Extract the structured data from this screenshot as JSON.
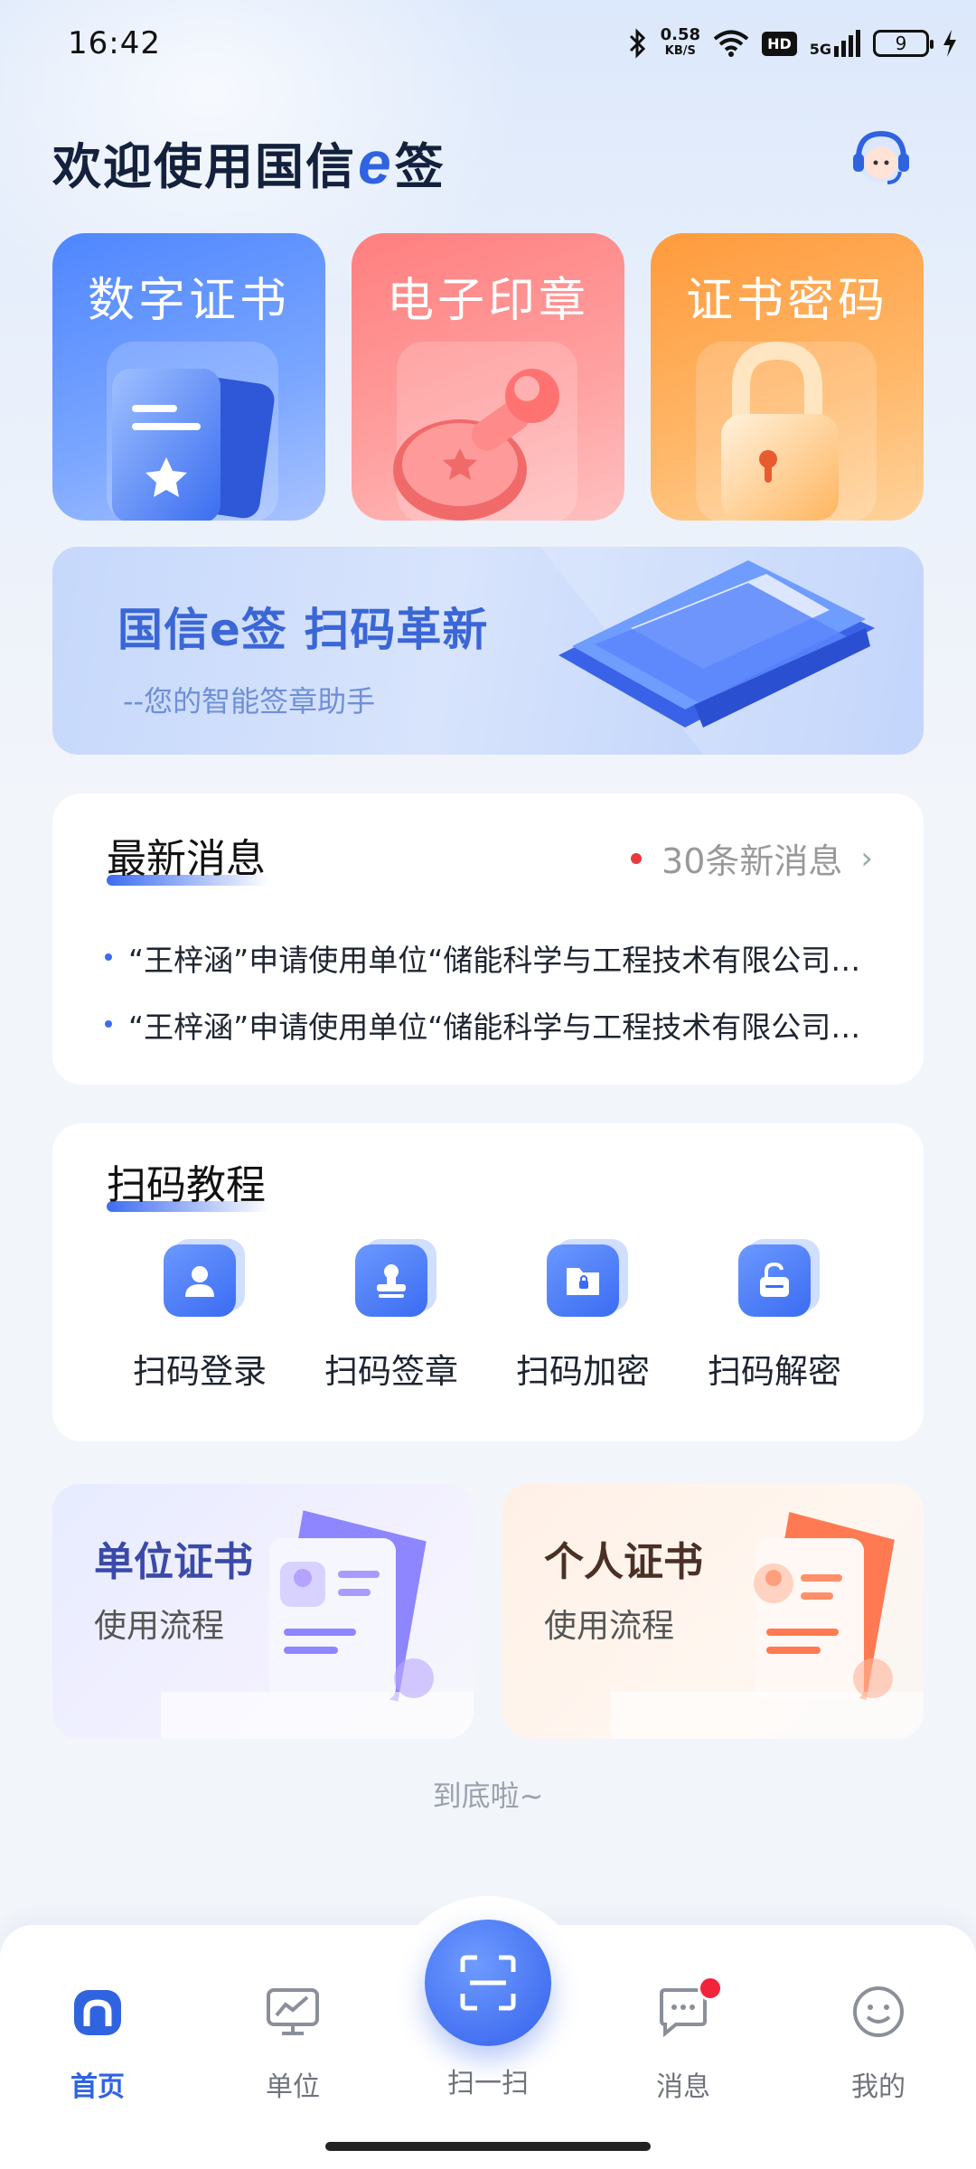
{
  "status_bar": {
    "time": "16:42",
    "net_speed_value": "0.58",
    "net_speed_unit": "KB/S",
    "hd_label": "HD",
    "signal_label": "5G",
    "battery_level": "9"
  },
  "header": {
    "title_prefix": "欢迎使用国信",
    "title_e": "e",
    "title_suffix": "签"
  },
  "feature_cards": [
    {
      "label": "数字证书"
    },
    {
      "label": "电子印章"
    },
    {
      "label": "证书密码"
    }
  ],
  "banner": {
    "headline": "国信e签 扫码革新",
    "subline": "--您的智能签章助手"
  },
  "news": {
    "title": "最新消息",
    "count_label": "30条新消息",
    "items": [
      "“王梓涵”申请使用单位“储能科学与工程技术有限公司”的数字证书",
      "“王梓涵”申请使用单位“储能科学与工程技术有限公司”的数字证书"
    ]
  },
  "tutorial": {
    "title": "扫码教程",
    "items": [
      {
        "label": "扫码登录",
        "icon": "user-icon"
      },
      {
        "label": "扫码签章",
        "icon": "stamp-icon"
      },
      {
        "label": "扫码加密",
        "icon": "folder-lock-icon"
      },
      {
        "label": "扫码解密",
        "icon": "unlock-icon"
      }
    ]
  },
  "usage_cards": [
    {
      "title": "单位证书",
      "subtitle": "使用流程"
    },
    {
      "title": "个人证书",
      "subtitle": "使用流程"
    }
  ],
  "bottom_hint": "到底啦~",
  "tabbar": {
    "tabs": [
      {
        "label": "首页",
        "icon": "home-icon",
        "active": true
      },
      {
        "label": "单位",
        "icon": "monitor-chart-icon",
        "active": false
      },
      {
        "label": "扫一扫",
        "icon": "scan-icon",
        "active": false
      },
      {
        "label": "消息",
        "icon": "chat-icon",
        "active": false
      },
      {
        "label": "我的",
        "icon": "smile-icon",
        "active": false
      }
    ]
  },
  "colors": {
    "primary": "#2f63e0",
    "title_dark": "#14213d",
    "badge_red": "#f2233a"
  }
}
